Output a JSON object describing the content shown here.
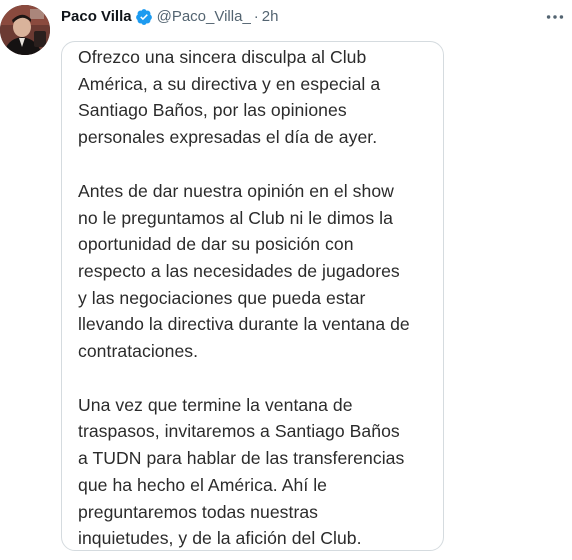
{
  "tweet": {
    "author": {
      "name": "Paco Villa",
      "handle": "@Paco_Villa_",
      "separator": "·",
      "time": "2h",
      "verified": true
    },
    "icons": {
      "verified": "verified-badge-icon",
      "more": "more-horizontal-icon",
      "avatar": "profile-photo"
    },
    "colors": {
      "verified_blue": "#1d9bf0",
      "secondary_text": "#536471",
      "card_border": "#d5dbdf"
    },
    "image_text": {
      "paragraphs": [
        {
          "lines": [
            "Ofrezco una sincera disculpa al Club",
            "América, a su directiva y en especial a",
            "Santiago Baños, por las opiniones",
            "personales expresadas el día de ayer."
          ]
        },
        {
          "lines": [
            "Antes de dar nuestra opinión en el show",
            "no le preguntamos al Club ni le dimos la",
            "oportunidad de dar su posición con",
            "respecto a las necesidades de jugadores",
            "y las negociaciones que pueda estar",
            "llevando la directiva durante la ventana de",
            "contrataciones."
          ]
        },
        {
          "lines": [
            "Una vez que termine la ventana de",
            "traspasos, invitaremos a Santiago Baños",
            "a TUDN para hablar de las transferencias",
            "que ha hecho el América. Ahí le",
            "preguntaremos todas nuestras",
            "inquietudes, y de la afición del Club."
          ]
        }
      ]
    }
  }
}
